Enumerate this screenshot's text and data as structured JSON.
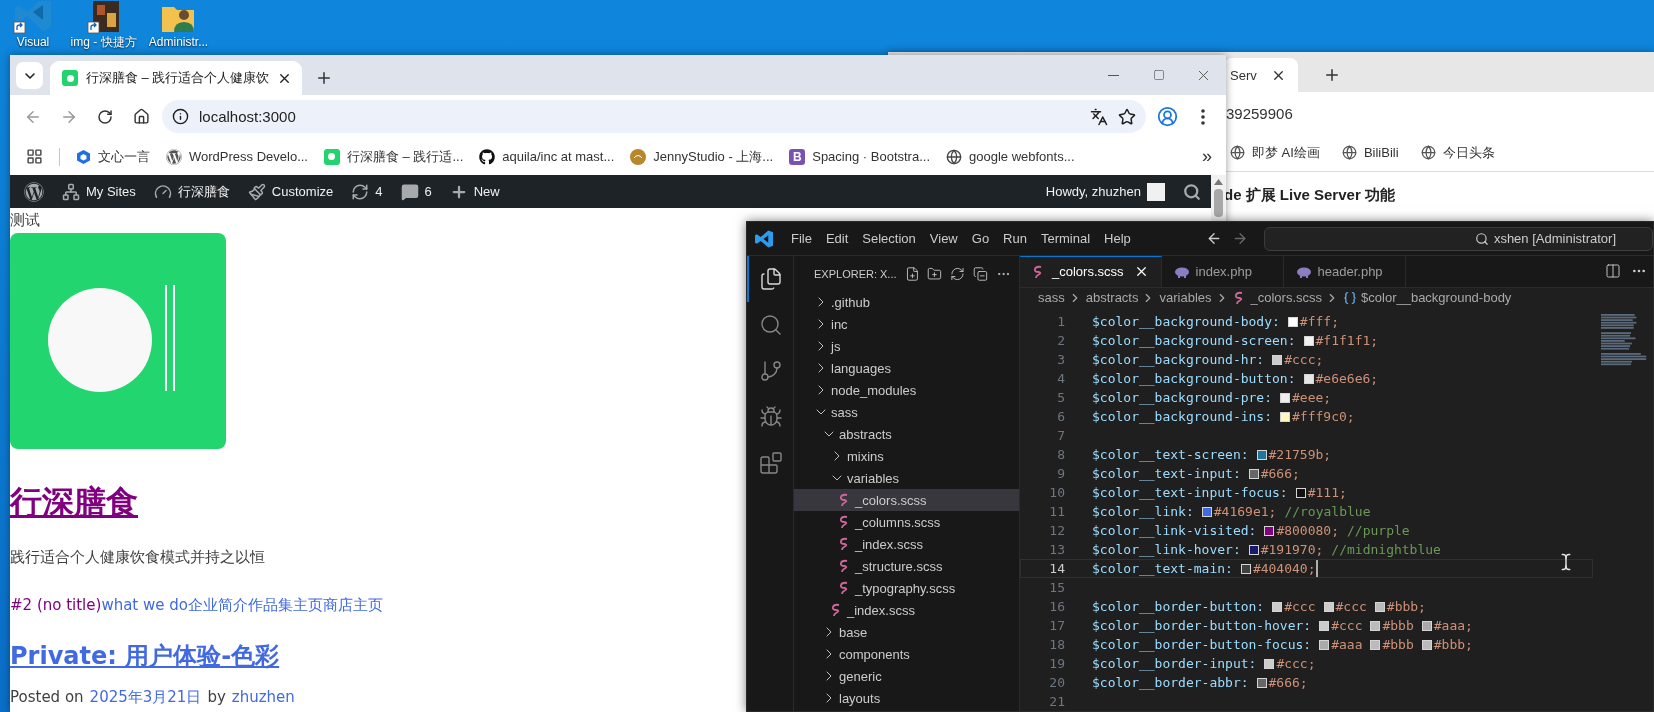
{
  "desktop": {
    "icons": [
      {
        "label": "Visual",
        "kind": "editor"
      },
      {
        "label": "img - 快捷方",
        "kind": "photo"
      },
      {
        "label": "Administr...",
        "kind": "user-folder"
      }
    ]
  },
  "back_browser": {
    "tab_title": "Serv",
    "address": "39259906",
    "bookmarks": [
      {
        "label": "即梦 AI绘画"
      },
      {
        "label": "BiliBili"
      },
      {
        "label": "今日头条"
      }
    ],
    "heading": "de 扩展 Live Server 功能"
  },
  "browser": {
    "tabs": [
      {
        "title": "行深膳食 – 践行适合个人健康饮",
        "selected": true
      }
    ],
    "address": "localhost:3000",
    "bookmarks": [
      {
        "label": "文心一言",
        "kind": "hexagon"
      },
      {
        "label": "WordPress Develo...",
        "kind": "wordpress"
      },
      {
        "label": "行深膳食 – 践行适...",
        "kind": "site"
      },
      {
        "label": "aquila/inc at mast...",
        "kind": "github"
      },
      {
        "label": "JennyStudio - 上海...",
        "kind": "badge"
      },
      {
        "label": "Spacing · Bootstra...",
        "kind": "letter",
        "letter": "B"
      },
      {
        "label": "google webfonts...",
        "kind": "globe"
      }
    ],
    "more": "»",
    "admin_bar": {
      "items": [
        {
          "kind": "logo"
        },
        {
          "kind": "sites",
          "label": "My Sites"
        },
        {
          "kind": "dashboard",
          "label": "行深膳食"
        },
        {
          "kind": "customize",
          "label": "Customize"
        },
        {
          "kind": "updates",
          "label": "4"
        },
        {
          "kind": "comments",
          "label": "6"
        },
        {
          "kind": "new",
          "label": "New"
        }
      ],
      "greeting": "Howdy, zhuzhen"
    },
    "page": {
      "note": "测试",
      "site_title": {
        "text": "行深膳食",
        "visited": true
      },
      "tagline": "践行适合个人健康饮食模式并持之以恒",
      "menu": [
        {
          "label": "#2 (no title)",
          "visited": true
        },
        {
          "label": "what we do",
          "visited": false
        },
        {
          "label": "企业简介",
          "visited": false
        },
        {
          "label": "作品集",
          "visited": false
        },
        {
          "label": "主页",
          "visited": false
        },
        {
          "label": "商店主页",
          "visited": false
        }
      ],
      "post_title": {
        "text": "Private: 用户体验-色彩",
        "visited": false
      },
      "meta": {
        "prefix": "Posted on",
        "date": "2025年3月21日",
        "by": "by",
        "author": "zhuzhen"
      }
    }
  },
  "vscode": {
    "menu": [
      "File",
      "Edit",
      "Selection",
      "View",
      "Go",
      "Run",
      "Terminal",
      "Help"
    ],
    "search": "xshen [Administrator]",
    "activity": [
      {
        "kind": "explorer",
        "selected": true
      },
      {
        "kind": "search",
        "selected": false
      },
      {
        "kind": "source-control",
        "selected": false
      },
      {
        "kind": "run",
        "selected": false
      },
      {
        "kind": "extensions",
        "selected": false
      }
    ],
    "explorer_title": "EXPLORER: X...",
    "tree": [
      {
        "label": ".github",
        "kind": "folder",
        "expanded": false,
        "selected": false
      },
      {
        "label": "inc",
        "kind": "folder",
        "expanded": false,
        "selected": false
      },
      {
        "label": "js",
        "kind": "folder",
        "expanded": false,
        "selected": false
      },
      {
        "label": "languages",
        "kind": "folder",
        "expanded": false,
        "selected": false
      },
      {
        "label": "node_modules",
        "kind": "folder",
        "expanded": false,
        "selected": false
      },
      {
        "label": "sass",
        "kind": "folder",
        "expanded": true,
        "selected": false,
        "children": [
          {
            "label": "abstracts",
            "kind": "folder",
            "expanded": true,
            "selected": false,
            "children": [
              {
                "label": "mixins",
                "kind": "folder",
                "expanded": false,
                "selected": false
              },
              {
                "label": "variables",
                "kind": "folder",
                "expanded": true,
                "selected": false,
                "children": [
                  {
                    "label": "_colors.scss",
                    "kind": "file",
                    "selected": true
                  },
                  {
                    "label": "_columns.scss",
                    "kind": "file",
                    "selected": false
                  },
                  {
                    "label": "_index.scss",
                    "kind": "file",
                    "selected": false
                  },
                  {
                    "label": "_structure.scss",
                    "kind": "file",
                    "selected": false
                  },
                  {
                    "label": "_typography.scss",
                    "kind": "file",
                    "selected": false
                  }
                ]
              },
              {
                "label": "_index.scss",
                "kind": "file",
                "selected": false
              }
            ]
          },
          {
            "label": "base",
            "kind": "folder",
            "expanded": false,
            "selected": false
          },
          {
            "label": "components",
            "kind": "folder",
            "expanded": false,
            "selected": false
          },
          {
            "label": "generic",
            "kind": "folder",
            "expanded": false,
            "selected": false
          },
          {
            "label": "layouts",
            "kind": "folder",
            "expanded": false,
            "selected": false
          }
        ]
      }
    ],
    "tabs": [
      {
        "label": "_colors.scss",
        "kind": "scss",
        "selected": true
      },
      {
        "label": "index.php",
        "kind": "php",
        "selected": false
      },
      {
        "label": "header.php",
        "kind": "php",
        "selected": false
      }
    ],
    "breadcrumb": [
      {
        "label": "sass",
        "kind": "folder"
      },
      {
        "label": "abstracts",
        "kind": "folder"
      },
      {
        "label": "variables",
        "kind": "folder"
      },
      {
        "label": "_colors.scss",
        "kind": "scss"
      },
      {
        "label": "$color__background-body",
        "kind": "symbol"
      }
    ],
    "lines": [
      {
        "number": "1",
        "current": false,
        "name": "$color__background-body:",
        "values": [
          {
            "color": "#ffffff",
            "text": "#fff;"
          }
        ]
      },
      {
        "number": "2",
        "current": false,
        "name": "$color__background-screen:",
        "values": [
          {
            "color": "#f1f1f1",
            "text": "#f1f1f1;"
          }
        ]
      },
      {
        "number": "3",
        "current": false,
        "name": "$color__background-hr:",
        "values": [
          {
            "color": "#cccccc",
            "text": "#ccc;"
          }
        ]
      },
      {
        "number": "4",
        "current": false,
        "name": "$color__background-button:",
        "values": [
          {
            "color": "#e6e6e6",
            "text": "#e6e6e6;"
          }
        ]
      },
      {
        "number": "5",
        "current": false,
        "name": "$color__background-pre:",
        "values": [
          {
            "color": "#eeeeee",
            "text": "#eee;"
          }
        ]
      },
      {
        "number": "6",
        "current": false,
        "name": "$color__background-ins:",
        "values": [
          {
            "color": "#fff9c0",
            "text": "#fff9c0;"
          }
        ]
      },
      {
        "number": "7",
        "current": false
      },
      {
        "number": "8",
        "current": false,
        "name": "$color__text-screen:",
        "values": [
          {
            "color": "#21759b",
            "text": "#21759b;"
          }
        ]
      },
      {
        "number": "9",
        "current": false,
        "name": "$color__text-input:",
        "values": [
          {
            "color": "#666666",
            "text": "#666;"
          }
        ]
      },
      {
        "number": "10",
        "current": false,
        "name": "$color__text-input-focus:",
        "values": [
          {
            "color": "#111111",
            "text": "#111;"
          }
        ]
      },
      {
        "number": "11",
        "current": false,
        "name": "$color__link:",
        "values": [
          {
            "color": "#4169e1",
            "text": "#4169e1;"
          }
        ],
        "comment": "//royalblue"
      },
      {
        "number": "12",
        "current": false,
        "name": "$color__link-visited:",
        "values": [
          {
            "color": "#800080",
            "text": "#800080;"
          }
        ],
        "comment": "//purple"
      },
      {
        "number": "13",
        "current": false,
        "name": "$color__link-hover:",
        "values": [
          {
            "color": "#191970",
            "text": "#191970;"
          }
        ],
        "comment": "//midnightblue"
      },
      {
        "number": "14",
        "current": true,
        "name": "$color__text-main:",
        "values": [
          {
            "color": "#404040",
            "text": "#404040;"
          }
        ]
      },
      {
        "number": "15",
        "current": false
      },
      {
        "number": "16",
        "current": false,
        "name": "$color__border-button:",
        "values": [
          {
            "color": "#cccccc",
            "text": "#ccc"
          },
          {
            "color": "#cccccc",
            "text": "#ccc"
          },
          {
            "color": "#bbbbbb",
            "text": "#bbb;"
          }
        ]
      },
      {
        "number": "17",
        "current": false,
        "name": "$color__border-button-hover:",
        "values": [
          {
            "color": "#cccccc",
            "text": "#ccc"
          },
          {
            "color": "#bbbbbb",
            "text": "#bbb"
          },
          {
            "color": "#aaaaaa",
            "text": "#aaa;"
          }
        ]
      },
      {
        "number": "18",
        "current": false,
        "name": "$color__border-button-focus:",
        "values": [
          {
            "color": "#aaaaaa",
            "text": "#aaa"
          },
          {
            "color": "#bbbbbb",
            "text": "#bbb"
          },
          {
            "color": "#bbbbbb",
            "text": "#bbb;"
          }
        ]
      },
      {
        "number": "19",
        "current": false,
        "name": "$color__border-input:",
        "values": [
          {
            "color": "#cccccc",
            "text": "#ccc;"
          }
        ]
      },
      {
        "number": "20",
        "current": false,
        "name": "$color__border-abbr:",
        "values": [
          {
            "color": "#666666",
            "text": "#666;"
          }
        ]
      },
      {
        "number": "21",
        "current": false
      }
    ]
  }
}
